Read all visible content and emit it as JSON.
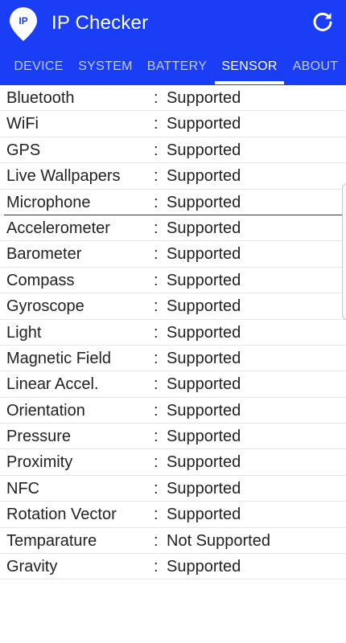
{
  "header": {
    "title": "IP Checker",
    "logo_text": "IP"
  },
  "tabs": [
    {
      "label": "DEVICE"
    },
    {
      "label": "SYSTEM"
    },
    {
      "label": "BATTERY"
    },
    {
      "label": "SENSOR",
      "active": true
    },
    {
      "label": "ABOUT"
    }
  ],
  "separator": ":",
  "features": [
    {
      "name": "Bluetooth",
      "status": "Supported"
    },
    {
      "name": "WiFi",
      "status": "Supported"
    },
    {
      "name": "GPS",
      "status": "Supported"
    },
    {
      "name": "Live Wallpapers",
      "status": "Supported"
    },
    {
      "name": "Microphone",
      "status": "Supported"
    }
  ],
  "sensors": [
    {
      "name": "Accelerometer",
      "status": "Supported"
    },
    {
      "name": "Barometer",
      "status": "Supported"
    },
    {
      "name": "Compass",
      "status": "Supported"
    },
    {
      "name": "Gyroscope",
      "status": "Supported"
    },
    {
      "name": "Light",
      "status": "Supported"
    },
    {
      "name": "Magnetic Field",
      "status": "Supported"
    },
    {
      "name": "Linear Accel.",
      "status": "Supported"
    },
    {
      "name": "Orientation",
      "status": "Supported"
    },
    {
      "name": "Pressure",
      "status": "Supported"
    },
    {
      "name": "Proximity",
      "status": "Supported"
    },
    {
      "name": "NFC",
      "status": "Supported"
    },
    {
      "name": "Rotation Vector",
      "status": "Supported"
    },
    {
      "name": "Temparature",
      "status": "Not Supported"
    },
    {
      "name": "Gravity",
      "status": "Supported"
    }
  ],
  "colors": {
    "appbar": "#1a3ef5",
    "text": "#222222"
  }
}
